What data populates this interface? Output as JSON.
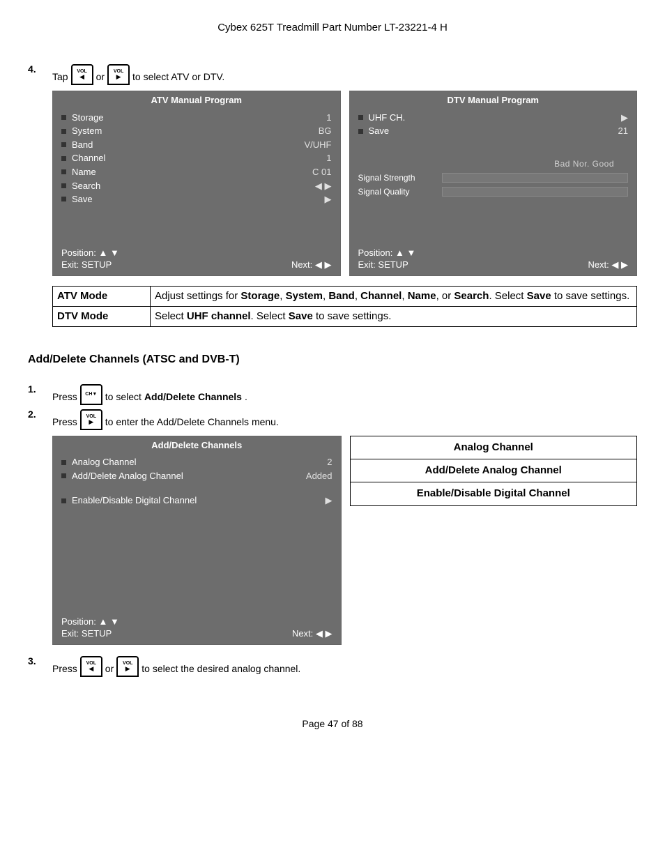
{
  "header": "Cybex 625T Treadmill Part Number LT-23221-4 H",
  "step4": {
    "num": "4.",
    "pre": "Tap",
    "or": "or",
    "post": "to select ATV or DTV."
  },
  "icons": {
    "vol": "VOL",
    "ch": "CH"
  },
  "atvPanel": {
    "title": "ATV Manual Program",
    "rows": [
      {
        "label": "Storage",
        "val": "1"
      },
      {
        "label": "System",
        "val": "BG"
      },
      {
        "label": "Band",
        "val": "V/UHF"
      },
      {
        "label": "Channel",
        "val": "1"
      },
      {
        "label": "Name",
        "val": "C 01"
      },
      {
        "label": "Search",
        "val": "◀ ▶"
      },
      {
        "label": "Save",
        "val": "▶"
      }
    ],
    "footPos": "Position: ▲ ▼",
    "footExit": "Exit: SETUP",
    "footNext": "Next: ◀ ▶"
  },
  "dtvPanel": {
    "title": "DTV Manual Program",
    "rows": [
      {
        "label": "UHF CH.",
        "val": "▶"
      },
      {
        "label": "Save",
        "val": "21"
      }
    ],
    "meterHeader": "Bad  Nor.  Good",
    "m1": "Signal Strength",
    "m2": "Signal Quality",
    "footPos": "Position: ▲ ▼",
    "footExit": "Exit: SETUP",
    "footNext": "Next: ◀ ▶"
  },
  "modeTable": {
    "atvLabel": "ATV Mode",
    "atvDesc": {
      "pre": "Adjust settings for ",
      "b1": "Storage",
      "s1": ", ",
      "b2": "System",
      "s2": ", ",
      "b3": "Band",
      "s3": ", ",
      "b4": "Channel",
      "s4": ", ",
      "b5": "Name",
      "s5": ", or ",
      "b6": "Search",
      "s6": ". Select ",
      "b7": "Save",
      "post": " to save settings."
    },
    "dtvLabel": "DTV Mode",
    "dtvDesc": {
      "pre": "Select ",
      "b1": "UHF channel",
      "mid": ". Select ",
      "b2": "Save",
      "post": " to save settings."
    }
  },
  "sectionTitle": "Add/Delete Channels (ATSC and DVB-T)",
  "adStep1": {
    "num": "1.",
    "pre": "Press",
    "post": "to select ",
    "bold": "Add/Delete Channels",
    "dot": "."
  },
  "adStep2": {
    "num": "2.",
    "pre": "Press",
    "post": "to enter the Add/Delete Channels menu."
  },
  "adPanel": {
    "title": "Add/Delete Channels",
    "rows": [
      {
        "label": "Analog Channel",
        "val": "2"
      },
      {
        "label": "Add/Delete Analog Channel",
        "val": "Added"
      }
    ],
    "row3": {
      "label": "Enable/Disable Digital Channel",
      "val": "▶"
    },
    "footPos": "Position: ▲ ▼",
    "footExit": "Exit: SETUP",
    "footNext": "Next: ◀ ▶"
  },
  "optTable": {
    "r1": "Analog Channel",
    "r2": "Add/Delete Analog Channel",
    "r3": "Enable/Disable Digital Channel"
  },
  "adStep3": {
    "num": "3.",
    "pre": "Press",
    "or": "or",
    "post": "to select the desired analog channel."
  },
  "pageFooter": "Page 47 of 88"
}
